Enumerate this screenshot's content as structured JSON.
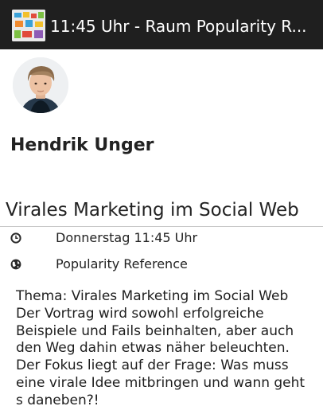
{
  "actionbar": {
    "title": "11:45 Uhr -  Raum Popularity R..."
  },
  "speaker": {
    "name": "Hendrik Unger"
  },
  "talk": {
    "title": "Virales Marketing im Social Web",
    "time": "Donnerstag 11:45 Uhr",
    "room": "Popularity Reference",
    "description": "Thema:  Virales Marketing im Social Web\nDer Vortrag wird sowohl erfolgreiche Beispiele und Fails beinhalten, aber auch den Weg dahin etwas näher beleuchten. Der Fokus liegt auf der Frage:  Was muss eine virale Idee mitbringen und wann geht s daneben?!"
  },
  "icons": {
    "time": "clock-icon",
    "room": "globe-icon",
    "app": "app-logo-icon"
  }
}
